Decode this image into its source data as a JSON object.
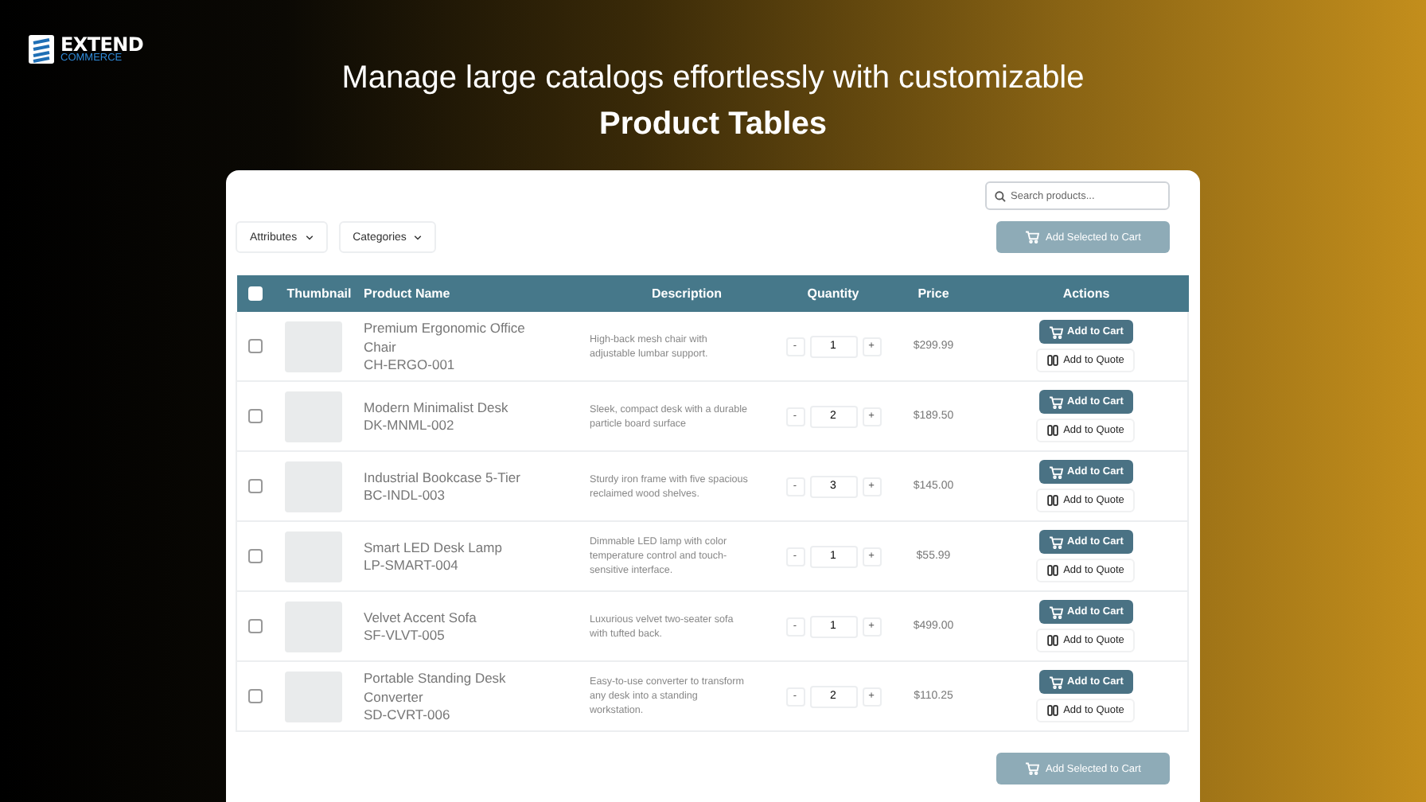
{
  "logo": {
    "name": "EXTEND",
    "tagline": "COMMERCE"
  },
  "headline": {
    "line_1": "Manage large catalogs effortlessly with customizable",
    "line_2": "Product Tables"
  },
  "toolbar": {
    "search": {
      "placeholder": "Search products..."
    },
    "filters": [
      {
        "label": "Attributes"
      },
      {
        "label": "Categories"
      }
    ],
    "add_selected": {
      "label": "Add Selected to Cart",
      "disabled": true
    }
  },
  "table": {
    "select_all": {
      "checked": false
    },
    "columns": [
      "Thumbnail",
      "Product Name",
      "Description",
      "Quantity",
      "Price",
      "Actions"
    ],
    "rows": [
      {
        "checked": false,
        "name": "Premium Ergonomic Office Chair",
        "sku": "CH-ERGO-001",
        "description": "High-back mesh chair with adjustable lumbar support.",
        "decrease": "-",
        "quantity": "1",
        "increase": "+",
        "price": "$299.99",
        "cart": "Add to Cart",
        "quote": "Add to Quote"
      },
      {
        "checked": false,
        "name": "Modern Minimalist Desk",
        "sku": "DK-MNML-002",
        "description": "Sleek, compact desk with a durable particle board surface",
        "decrease": "-",
        "quantity": "2",
        "increase": "+",
        "price": "$189.50",
        "cart": "Add to Cart",
        "quote": "Add to Quote"
      },
      {
        "checked": false,
        "name": "Industrial Bookcase 5-Tier",
        "sku": "BC-INDL-003",
        "description": "Sturdy iron frame with five spacious reclaimed wood shelves.",
        "decrease": "-",
        "quantity": "3",
        "increase": "+",
        "price": "$145.00",
        "cart": "Add to Cart",
        "quote": "Add to Quote"
      },
      {
        "checked": false,
        "name": "Smart LED Desk Lamp",
        "sku": "LP-SMART-004",
        "description": "Dimmable LED lamp with color temperature control and touch-sensitive interface.",
        "decrease": "-",
        "quantity": "1",
        "increase": "+",
        "price": "$55.99",
        "cart": "Add to Cart",
        "quote": "Add to Quote"
      },
      {
        "checked": false,
        "name": "Velvet Accent Sofa",
        "sku": "SF-VLVT-005",
        "description": "Luxurious velvet two-seater sofa with tufted back.",
        "decrease": "-",
        "quantity": "1",
        "increase": "+",
        "price": "$499.00",
        "cart": "Add to Cart",
        "quote": "Add to Quote"
      },
      {
        "checked": false,
        "name": "Portable Standing Desk Converter",
        "sku": "SD-CVRT-006",
        "description": "Easy-to-use converter to transform any desk into a standing workstation.",
        "decrease": "-",
        "quantity": "2",
        "increase": "+",
        "price": "$110.25",
        "cart": "Add to Cart",
        "quote": "Add to Quote"
      }
    ]
  },
  "footer": {
    "add_selected": {
      "label": "Add Selected to Cart",
      "disabled": true
    }
  }
}
